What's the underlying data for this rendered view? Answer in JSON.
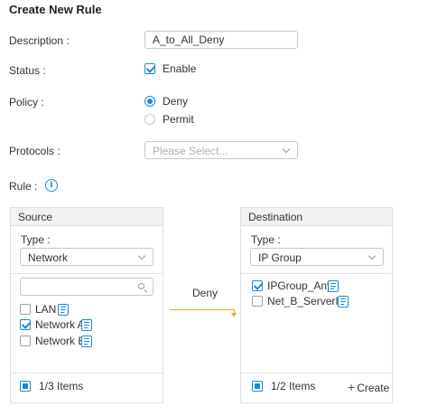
{
  "page": {
    "title": "Create New Rule"
  },
  "form": {
    "description": {
      "label": "Description",
      "value": "A_to_All_Deny"
    },
    "status": {
      "label": "Status",
      "option": "Enable",
      "checked": true
    },
    "policy": {
      "label": "Policy",
      "options": [
        "Deny",
        "Permit"
      ],
      "selected": "Deny"
    },
    "protocols": {
      "label": "Protocols",
      "placeholder": "Please Select..."
    },
    "rule": {
      "label": "Rule"
    }
  },
  "source": {
    "header": "Source",
    "type_label": "Type",
    "type_value": "Network",
    "items": [
      {
        "label": "LAN",
        "checked": false
      },
      {
        "label": "Network A",
        "checked": true
      },
      {
        "label": "Network B",
        "checked": false
      }
    ],
    "count": "1/3 Items"
  },
  "action": {
    "label": "Deny",
    "color": "#f5a623"
  },
  "destination": {
    "header": "Destination",
    "type_label": "Type",
    "type_value": "IP Group",
    "items": [
      {
        "label": "IPGroup_Any",
        "checked": true
      },
      {
        "label": "Net_B_ServerIP",
        "checked": false
      }
    ],
    "count": "1/2 Items",
    "create_label": "Create"
  },
  "colors": {
    "accent": "#1e8ad8",
    "border": "#c8c8c8",
    "header_bg": "#f2f2f2"
  }
}
